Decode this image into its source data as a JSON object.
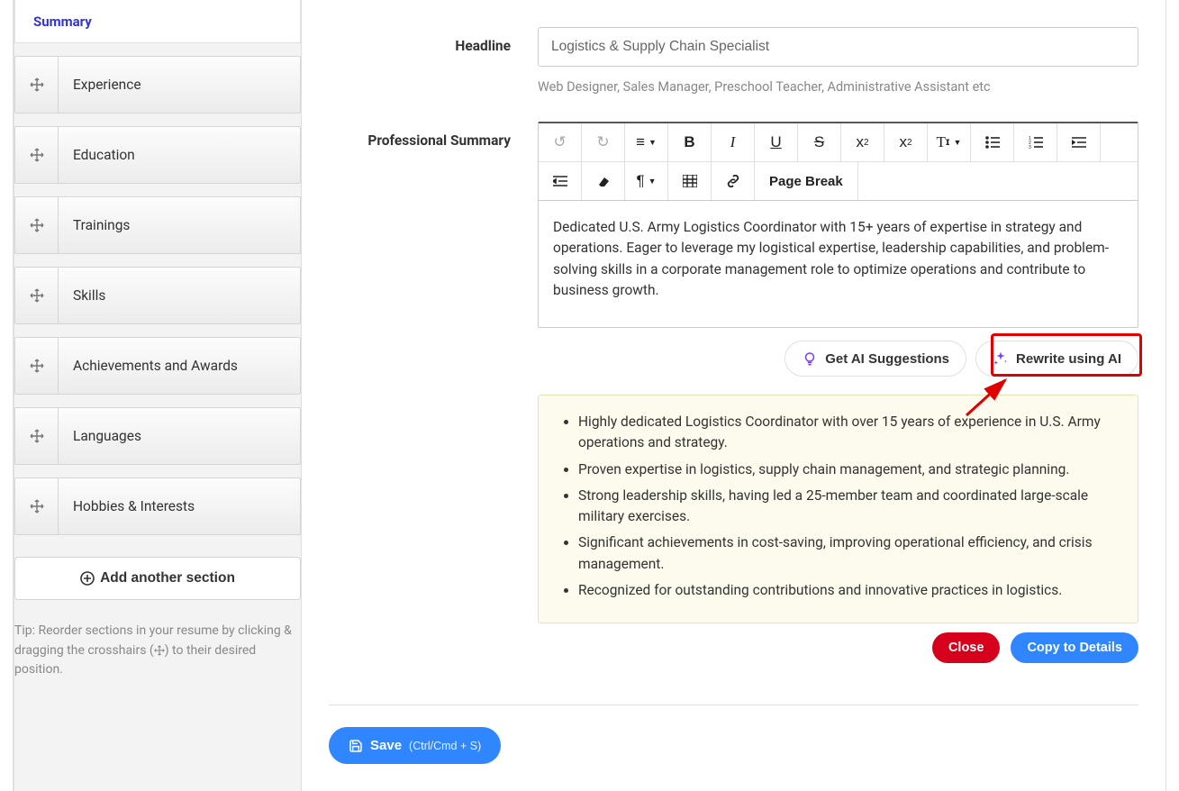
{
  "sidebar": {
    "active_section": "Summary",
    "items": [
      {
        "label": "Experience"
      },
      {
        "label": "Education"
      },
      {
        "label": "Trainings"
      },
      {
        "label": "Skills"
      },
      {
        "label": "Achievements and Awards"
      },
      {
        "label": "Languages"
      },
      {
        "label": "Hobbies & Interests"
      }
    ],
    "add_button": "Add another section",
    "tip_prefix": "Tip: Reorder sections in your resume by clicking & dragging the crosshairs (",
    "tip_suffix": ") to their desired position."
  },
  "form": {
    "headline_label": "Headline",
    "headline_value": "Logistics & Supply Chain Specialist",
    "headline_help": "Web Designer, Sales Manager, Preschool Teacher, Administrative Assistant etc",
    "summary_label": "Professional Summary",
    "summary_text": "Dedicated U.S. Army Logistics Coordinator with 15+ years of expertise in strategy and operations. Eager to leverage my logistical expertise, leadership capabilities, and problem-solving skills in a corporate management role to optimize operations and contribute to business growth.",
    "page_break": "Page Break"
  },
  "ai": {
    "get_suggestions": "Get AI Suggestions",
    "rewrite": "Rewrite using AI"
  },
  "suggestions": [
    "Highly dedicated Logistics Coordinator with over 15 years of experience in U.S. Army operations and strategy.",
    "Proven expertise in logistics, supply chain management, and strategic planning.",
    "Strong leadership skills, having led a 25-member team and coordinated large-scale military exercises.",
    "Significant achievements in cost-saving, improving operational efficiency, and crisis management.",
    "Recognized for outstanding contributions and innovative practices in logistics."
  ],
  "actions": {
    "close": "Close",
    "copy": "Copy to Details",
    "save": "Save",
    "save_shortcut": "(Ctrl/Cmd + S)"
  }
}
